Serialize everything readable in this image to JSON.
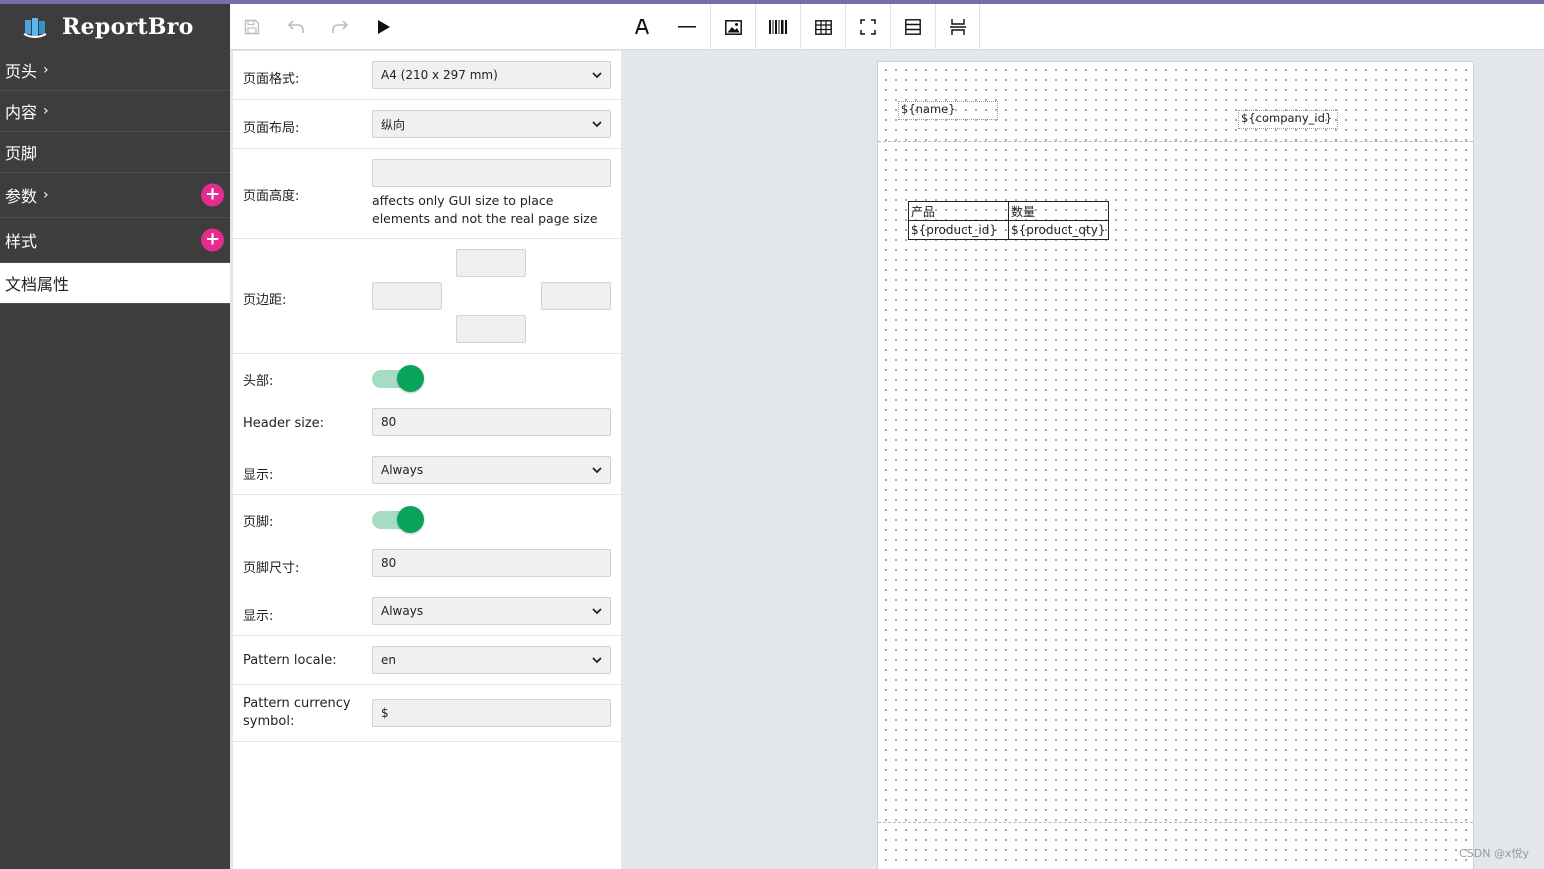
{
  "app": {
    "name": "ReportBro"
  },
  "sidebar": {
    "items": [
      {
        "label": "页头",
        "chevron": "›"
      },
      {
        "label": "内容",
        "chevron": "›"
      },
      {
        "label": "页脚"
      },
      {
        "label": "参数",
        "chevron": "›",
        "add": "+"
      },
      {
        "label": "样式",
        "add": "+"
      },
      {
        "label": "文档属性"
      }
    ]
  },
  "toolbar": {
    "icons": [
      "save-icon",
      "undo-icon",
      "redo-icon",
      "play-icon",
      "text-icon",
      "line-icon",
      "image-icon",
      "barcode-icon",
      "table-icon",
      "frame-icon",
      "section-icon",
      "page-break-icon"
    ]
  },
  "props": {
    "page_format": {
      "label": "页面格式:",
      "value": "A4 (210 x 297 mm)"
    },
    "orientation": {
      "label": "页面布局:",
      "value": "纵向"
    },
    "content_height": {
      "label": "页面高度:",
      "value": "",
      "hint": "affects only GUI size to place elements and not the real page size"
    },
    "margins": {
      "label": "页边距:"
    },
    "header": {
      "label": "头部:",
      "enabled": true
    },
    "header_size": {
      "label": "Header size:",
      "value": "80"
    },
    "header_display": {
      "label": "显示:",
      "value": "Always"
    },
    "footer": {
      "label": "页脚:",
      "enabled": true
    },
    "footer_size": {
      "label": "页脚尺寸:",
      "value": "80"
    },
    "footer_display": {
      "label": "显示:",
      "value": "Always"
    },
    "pattern_locale": {
      "label": "Pattern locale:",
      "value": "en"
    },
    "pattern_currency": {
      "label": "Pattern currency symbol:",
      "value": "$"
    }
  },
  "canvas": {
    "header_elements": [
      "${name}",
      "${company_id}"
    ],
    "table": {
      "headers": [
        "产品",
        "数量"
      ],
      "row": [
        "${product_id}",
        "${product_qty}"
      ]
    }
  },
  "watermark": "CSDN @x悦y",
  "colors": {
    "accent": "#e52b8e",
    "toggle": "#0aa35c",
    "sidebar": "#3d3d3d"
  }
}
